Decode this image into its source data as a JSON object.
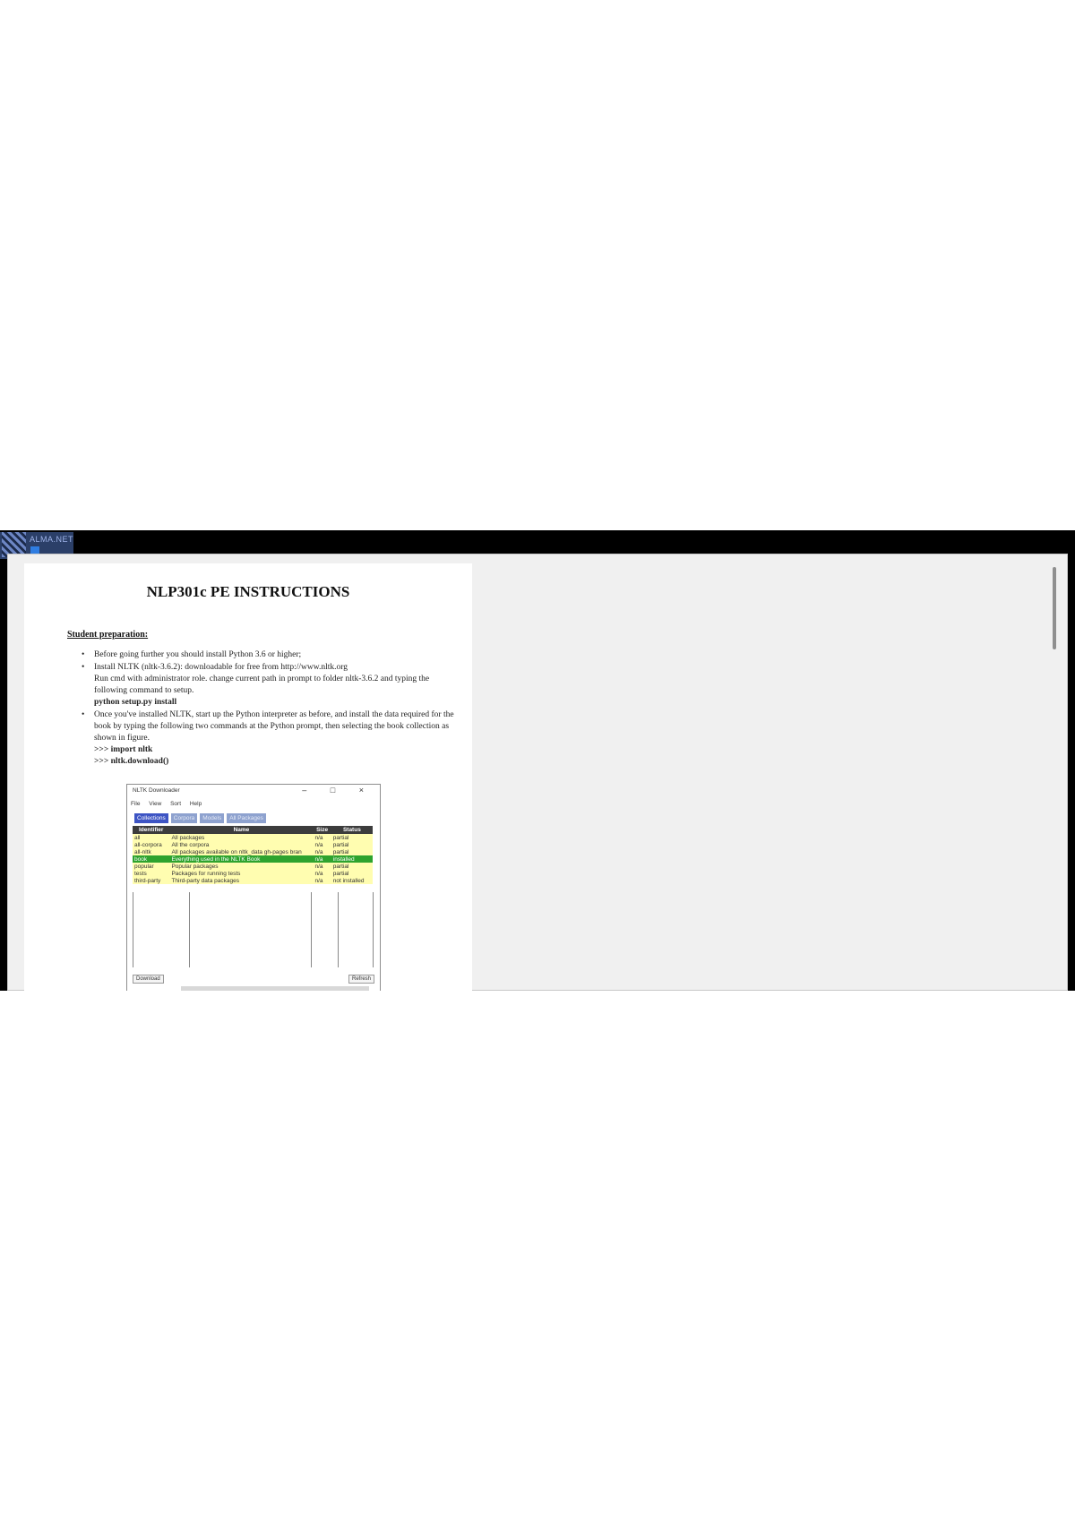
{
  "logo": {
    "text": "ALMA.NET"
  },
  "document": {
    "title": "NLP301c PE INSTRUCTIONS",
    "section_heading": "Student preparation:",
    "bullets": [
      {
        "text": "Before going further you should install Python 3.6 or higher;"
      },
      {
        "text": "Install NLTK (nltk-3.6.2): downloadable for free from http://www.nltk.org",
        "note": "Run cmd with administrator role. change current path in prompt to folder nltk-3.6.2 and typing the following command to setup.",
        "code": "python setup.py install"
      },
      {
        "text": "Once you've installed NLTK, start up the Python interpreter as before, and install the data required for the book by typing the following two commands at the Python prompt, then selecting the book collection as shown in figure.",
        "code1": ">>> import nltk",
        "code2": ">>> nltk.download()"
      }
    ]
  },
  "downloader": {
    "title": "NLTK Downloader",
    "controls": "– □ ×",
    "menu": [
      "File",
      "View",
      "Sort",
      "Help"
    ],
    "tabs": [
      "Collections",
      "Corpora",
      "Models",
      "All Packages"
    ],
    "columns": [
      "Identifier",
      "Name",
      "Size",
      "Status"
    ],
    "rows": [
      {
        "id": "all",
        "name": "All packages",
        "size": "n/a",
        "status": "partial"
      },
      {
        "id": "all-corpora",
        "name": "All the corpora",
        "size": "n/a",
        "status": "partial"
      },
      {
        "id": "all-nltk",
        "name": "All packages available on nltk_data gh-pages bran",
        "size": "n/a",
        "status": "partial"
      },
      {
        "id": "book",
        "name": "Everything used in the NLTK Book",
        "size": "n/a",
        "status": "installed"
      },
      {
        "id": "popular",
        "name": "Popular packages",
        "size": "n/a",
        "status": "partial"
      },
      {
        "id": "tests",
        "name": "Packages for running tests",
        "size": "n/a",
        "status": "partial"
      },
      {
        "id": "third-party",
        "name": "Third-party data packages",
        "size": "n/a",
        "status": "not installed"
      }
    ],
    "download_label": "Download",
    "refresh_label": "Refresh"
  }
}
